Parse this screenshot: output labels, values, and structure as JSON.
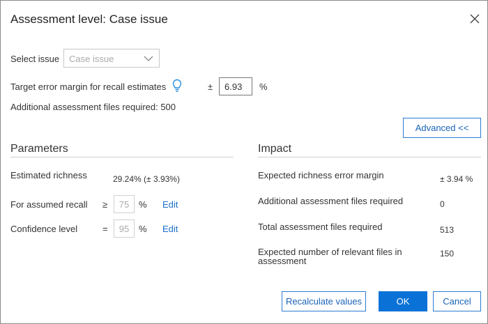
{
  "dialog": {
    "title": "Assessment level: Case issue"
  },
  "issue": {
    "label": "Select issue",
    "selected": "Case issue"
  },
  "target": {
    "label": "Target error margin for recall estimates",
    "plus_minus": "±",
    "value": "6.93",
    "unit": "%"
  },
  "additional_required": "Additional assessment files required: 500",
  "advanced_button": "Advanced <<",
  "parameters": {
    "title": "Parameters",
    "richness_label": "Estimated richness",
    "richness_value": "29.24% (± 3.93%)",
    "recall_label": "For assumed recall",
    "recall_operator": "≥",
    "recall_value": "75",
    "recall_unit": "%",
    "recall_edit": "Edit",
    "confidence_label": "Confidence level",
    "confidence_operator": "=",
    "confidence_value": "95",
    "confidence_unit": "%",
    "confidence_edit": "Edit"
  },
  "impact": {
    "title": "Impact",
    "rows": [
      {
        "label": "Expected richness error margin",
        "value": "± 3.94 %"
      },
      {
        "label": "Additional assessment files required",
        "value": "0"
      },
      {
        "label": "Total assessment files required",
        "value": "513"
      },
      {
        "label": "Expected number of relevant files in assessment",
        "value": "150"
      }
    ]
  },
  "footer": {
    "recalculate": "Recalculate values",
    "ok": "OK",
    "cancel": "Cancel"
  },
  "colors": {
    "accent": "#0a72d6",
    "link": "#1a6fc9",
    "border": "#8a8a8a"
  },
  "icons": [
    "close-icon",
    "chevron-down-icon",
    "lightbulb-icon"
  ]
}
